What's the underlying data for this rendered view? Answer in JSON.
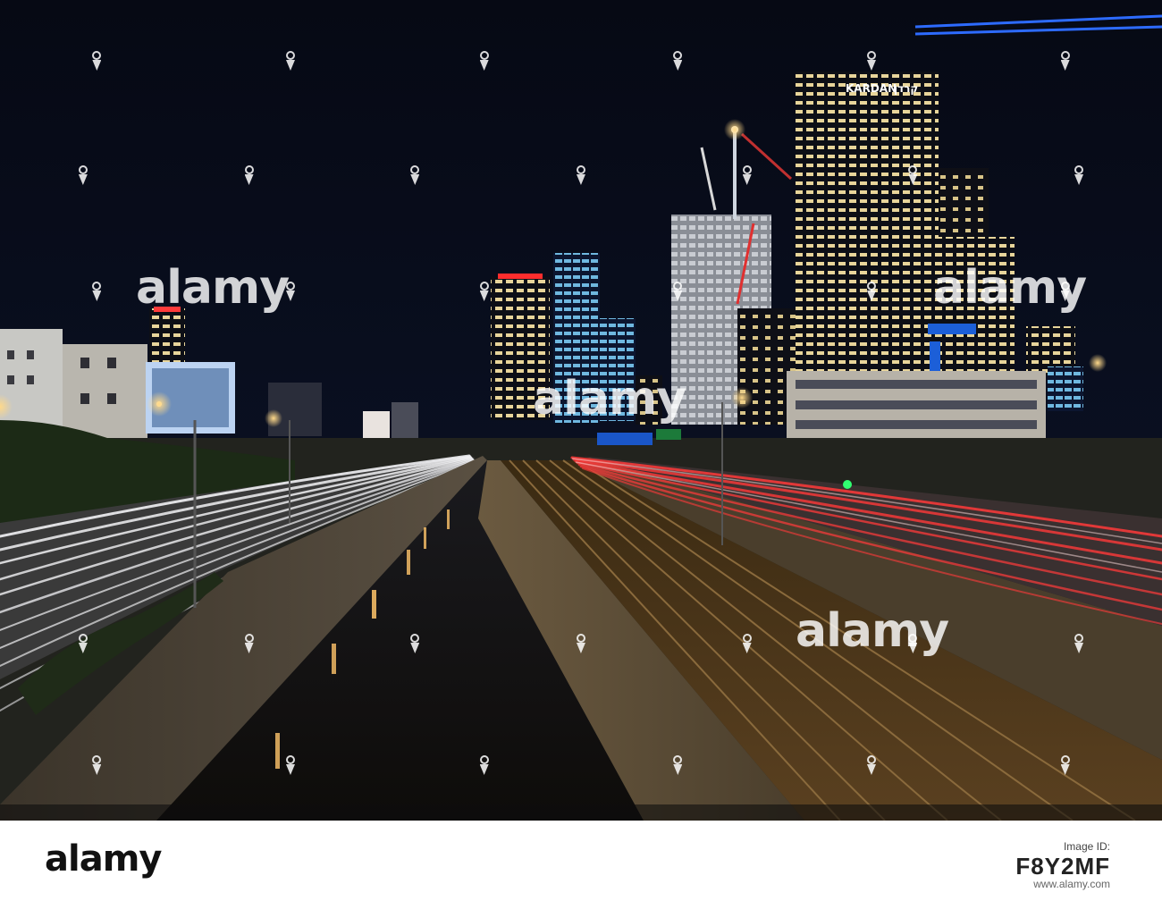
{
  "image": {
    "description_colors": {
      "sky": "#070b1a",
      "light_trail_white": "#f2f2f5",
      "light_trail_red": "#ff3a3a",
      "sodium_light": "#f2a040",
      "tower_glow": "#7fd0f0"
    }
  },
  "signs": {
    "kardan_label": "KARDAN",
    "kardan_hebrew": "קרדן"
  },
  "watermark": {
    "brand": "alamy",
    "icon": "alamy-a-icon"
  },
  "footer": {
    "logo": "alamy",
    "image_id_label": "Image ID:",
    "image_id": "F8Y2MF",
    "url": "www.alamy.com"
  }
}
